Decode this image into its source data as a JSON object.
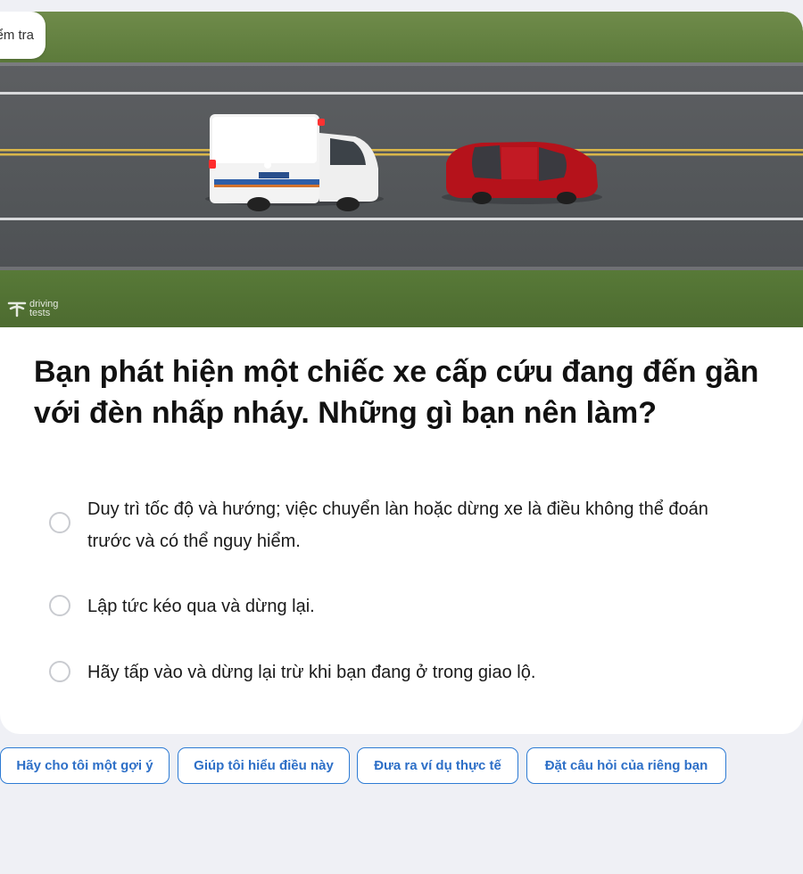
{
  "header": {
    "pill_label": "Kiểm tra"
  },
  "image": {
    "watermark_line1": "driving",
    "watermark_line2": "tests"
  },
  "question": {
    "text": "Bạn phát hiện một chiếc xe cấp cứu đang đến gần với đèn nhấp nháy. Những gì bạn nên làm?"
  },
  "options": [
    {
      "label": "Duy trì tốc độ và hướng; việc chuyển làn hoặc dừng xe là điều không thể đoán trước và có thể nguy hiểm."
    },
    {
      "label": "Lập tức kéo qua và dừng lại."
    },
    {
      "label": "Hãy tấp vào và dừng lại trừ khi bạn đang ở trong giao lộ."
    }
  ],
  "chips": [
    {
      "label": "Hãy cho tôi một gợi ý"
    },
    {
      "label": "Giúp tôi hiểu điều này"
    },
    {
      "label": "Đưa ra ví dụ thực tế"
    },
    {
      "label": "Đặt câu hỏi của riêng bạn"
    }
  ],
  "colors": {
    "accent": "#2d7bd4",
    "background": "#eff0f5",
    "car": "#b5121b"
  }
}
